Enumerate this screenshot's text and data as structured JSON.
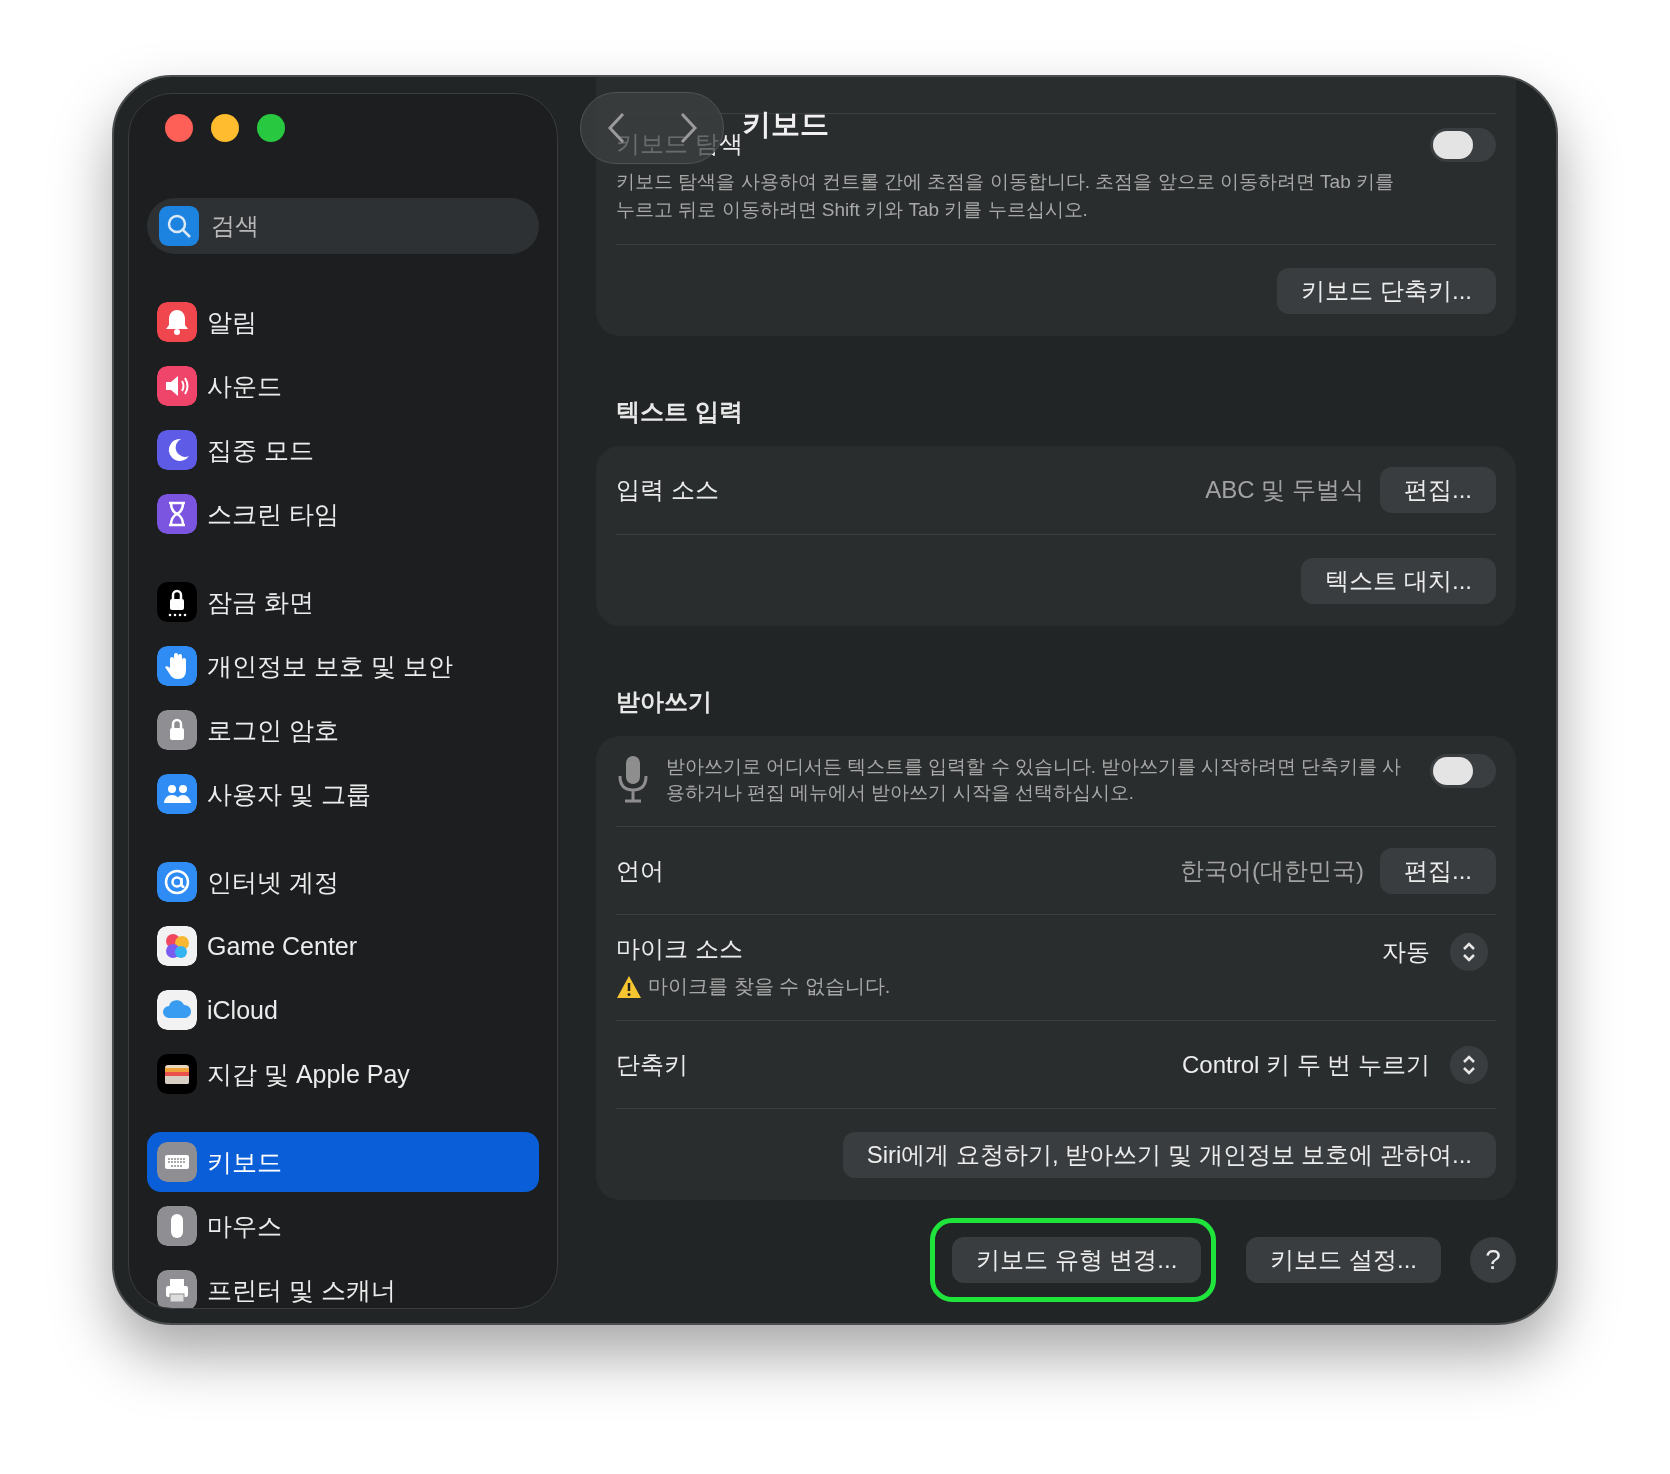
{
  "window": {
    "title": "키보드"
  },
  "sidebar": {
    "search": {
      "placeholder": "검색"
    },
    "groups": [
      [
        {
          "label": "알림",
          "color": "#f0474f",
          "selected": false
        },
        {
          "label": "사운드",
          "color": "#f0456a",
          "selected": false
        },
        {
          "label": "집중 모드",
          "color": "#5e5ce6",
          "selected": false
        },
        {
          "label": "스크린 타임",
          "color": "#7b55e0",
          "selected": false
        }
      ],
      [
        {
          "label": "잠금 화면",
          "color": "#000000",
          "selected": false
        },
        {
          "label": "개인정보 보호 및 보안",
          "color": "#2f8cf5",
          "selected": false
        },
        {
          "label": "로그인 암호",
          "color": "#8e8e93",
          "selected": false
        },
        {
          "label": "사용자 및 그룹",
          "color": "#2f8cf5",
          "selected": false
        }
      ],
      [
        {
          "label": "인터넷 계정",
          "color": "#2f8cf5",
          "selected": false
        },
        {
          "label": "Game Center",
          "color": "#f2f2f2",
          "selected": false
        },
        {
          "label": "iCloud",
          "color": "#f2f2f2",
          "selected": false
        },
        {
          "label": "지갑 및 Apple Pay",
          "color": "#000000",
          "selected": false
        }
      ],
      [
        {
          "label": "키보드",
          "color": "#8e8e93",
          "selected": true
        },
        {
          "label": "마우스",
          "color": "#8e8e93",
          "selected": false
        },
        {
          "label": "프린터 및 스캐너",
          "color": "#8e8e93",
          "selected": false
        }
      ]
    ]
  },
  "cards": [
    {
      "rows": [
        {
          "kind": "toggle",
          "label": "키보드 탐색",
          "description": "키보드 탐색을 사용하여 컨트롤 간에 초점을 이동합니다. 초점을 앞으로 이동하려면 Tab 키를 누르고 뒤로 이동하려면 Shift 키와 Tab 키를 누르십시오.",
          "on": false
        },
        {
          "kind": "button",
          "button": "키보드 단축키..."
        }
      ]
    },
    {
      "heading": "텍스트 입력",
      "rows": [
        {
          "kind": "value",
          "label": "입력 소스",
          "value": "ABC 및 두벌식",
          "button": "편집..."
        },
        {
          "kind": "button",
          "button": "텍스트 대치..."
        }
      ]
    },
    {
      "heading": "받아쓰기",
      "rows": [
        {
          "kind": "mic",
          "description": "받아쓰기로 어디서든 텍스트를 입력할 수 있습니다. 받아쓰기를 시작하려면 단축키를 사용하거나 편집 메뉴에서 받아쓰기 시작을 선택하십시오.",
          "on": false
        },
        {
          "kind": "value",
          "label": "언어",
          "value": "한국어(대한민국)",
          "button": "편집..."
        },
        {
          "kind": "popup",
          "label": "마이크 소스",
          "value": "자동",
          "warning": "마이크를 찾을 수 없습니다."
        },
        {
          "kind": "popup",
          "label": "단축키",
          "value": "Control 키 두 번 누르기"
        },
        {
          "kind": "button",
          "button": "Siri에게 요청하기, 받아쓰기 및 개인정보 보호에 관하여..."
        }
      ]
    }
  ],
  "footer": {
    "buttons": [
      {
        "label": "키보드 유형 변경...",
        "highlighted": true
      },
      {
        "label": "키보드 설정...",
        "highlighted": false
      }
    ],
    "help": "?"
  }
}
